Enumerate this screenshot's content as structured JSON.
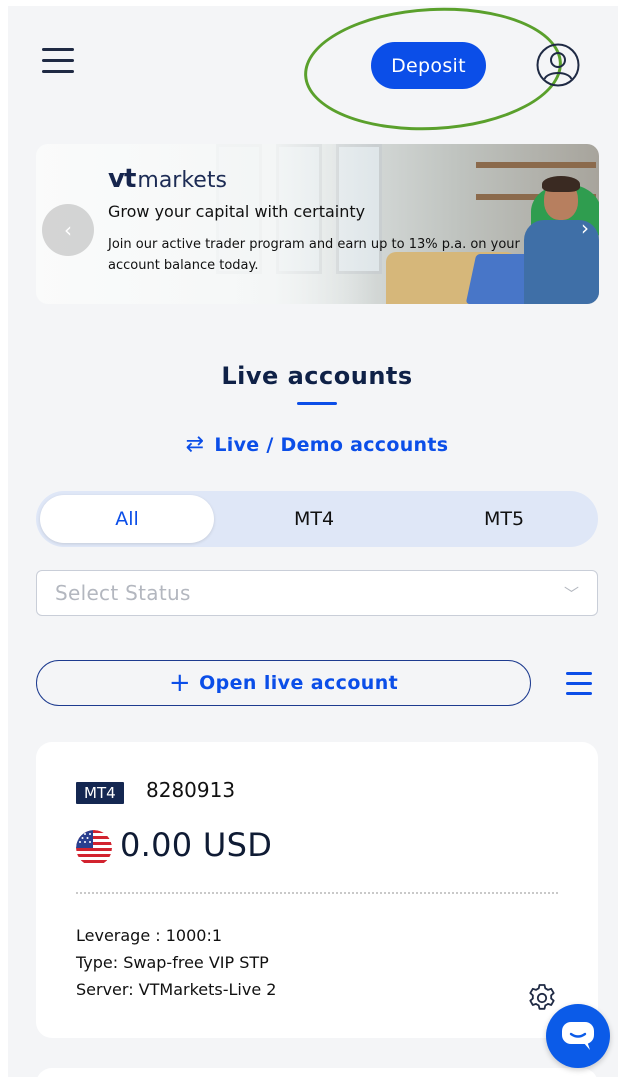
{
  "header": {
    "deposit_label": "Deposit"
  },
  "banner": {
    "logo_vt": "vt",
    "logo_markets": "markets",
    "headline": "Grow your capital with certainty",
    "body": "Join our active trader program and earn up to 13% p.a. on your account balance today.",
    "prev_icon": "chevron-left-icon",
    "next_icon": "chevron-right-icon"
  },
  "accounts": {
    "title": "Live accounts",
    "switch_label": "Live / Demo accounts",
    "tabs": [
      "All",
      "MT4",
      "MT5"
    ],
    "active_tab": "All",
    "status_placeholder": "Select Status",
    "open_account_label": "Open live account"
  },
  "account_card": {
    "platform": "MT4",
    "account_number": "8280913",
    "balance": "0.00 USD",
    "currency_flag": "us-flag-icon",
    "leverage": "Leverage : 1000:1",
    "type": "Type: Swap-free VIP STP",
    "server": "Server: VTMarkets-Live 2"
  },
  "colors": {
    "accent": "#0b4ee8",
    "navy": "#142751",
    "highlight_ring": "#5aa02c",
    "background": "#f4f5f7"
  }
}
